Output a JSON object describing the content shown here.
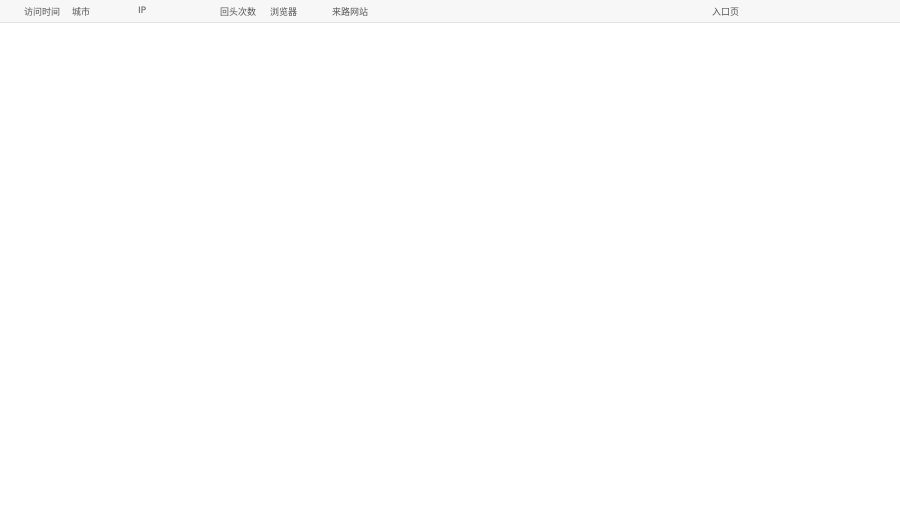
{
  "table": {
    "headers": [
      "",
      "访问时间",
      "城市",
      "IP",
      "回头次数",
      "浏览器",
      "来路网站",
      "入口页"
    ],
    "rows": []
  }
}
